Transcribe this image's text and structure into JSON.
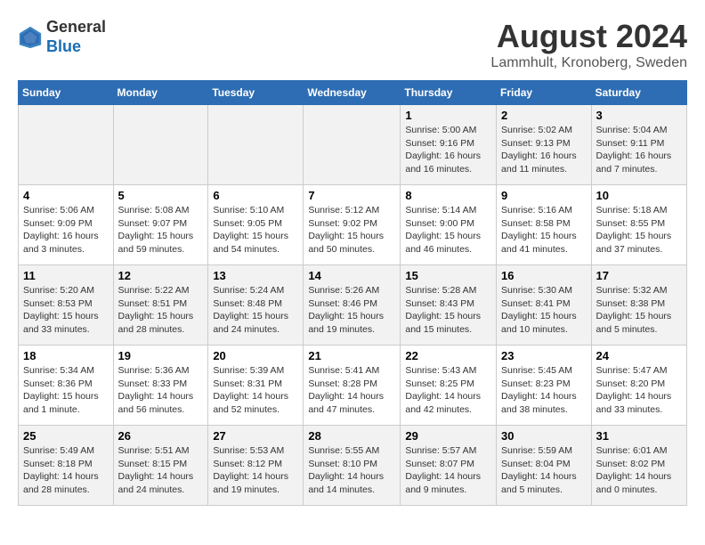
{
  "logo": {
    "general": "General",
    "blue": "Blue"
  },
  "title": "August 2024",
  "subtitle": "Lammhult, Kronoberg, Sweden",
  "weekdays": [
    "Sunday",
    "Monday",
    "Tuesday",
    "Wednesday",
    "Thursday",
    "Friday",
    "Saturday"
  ],
  "weeks": [
    [
      {
        "day": "",
        "info": ""
      },
      {
        "day": "",
        "info": ""
      },
      {
        "day": "",
        "info": ""
      },
      {
        "day": "",
        "info": ""
      },
      {
        "day": "1",
        "info": "Sunrise: 5:00 AM\nSunset: 9:16 PM\nDaylight: 16 hours\nand 16 minutes."
      },
      {
        "day": "2",
        "info": "Sunrise: 5:02 AM\nSunset: 9:13 PM\nDaylight: 16 hours\nand 11 minutes."
      },
      {
        "day": "3",
        "info": "Sunrise: 5:04 AM\nSunset: 9:11 PM\nDaylight: 16 hours\nand 7 minutes."
      }
    ],
    [
      {
        "day": "4",
        "info": "Sunrise: 5:06 AM\nSunset: 9:09 PM\nDaylight: 16 hours\nand 3 minutes."
      },
      {
        "day": "5",
        "info": "Sunrise: 5:08 AM\nSunset: 9:07 PM\nDaylight: 15 hours\nand 59 minutes."
      },
      {
        "day": "6",
        "info": "Sunrise: 5:10 AM\nSunset: 9:05 PM\nDaylight: 15 hours\nand 54 minutes."
      },
      {
        "day": "7",
        "info": "Sunrise: 5:12 AM\nSunset: 9:02 PM\nDaylight: 15 hours\nand 50 minutes."
      },
      {
        "day": "8",
        "info": "Sunrise: 5:14 AM\nSunset: 9:00 PM\nDaylight: 15 hours\nand 46 minutes."
      },
      {
        "day": "9",
        "info": "Sunrise: 5:16 AM\nSunset: 8:58 PM\nDaylight: 15 hours\nand 41 minutes."
      },
      {
        "day": "10",
        "info": "Sunrise: 5:18 AM\nSunset: 8:55 PM\nDaylight: 15 hours\nand 37 minutes."
      }
    ],
    [
      {
        "day": "11",
        "info": "Sunrise: 5:20 AM\nSunset: 8:53 PM\nDaylight: 15 hours\nand 33 minutes."
      },
      {
        "day": "12",
        "info": "Sunrise: 5:22 AM\nSunset: 8:51 PM\nDaylight: 15 hours\nand 28 minutes."
      },
      {
        "day": "13",
        "info": "Sunrise: 5:24 AM\nSunset: 8:48 PM\nDaylight: 15 hours\nand 24 minutes."
      },
      {
        "day": "14",
        "info": "Sunrise: 5:26 AM\nSunset: 8:46 PM\nDaylight: 15 hours\nand 19 minutes."
      },
      {
        "day": "15",
        "info": "Sunrise: 5:28 AM\nSunset: 8:43 PM\nDaylight: 15 hours\nand 15 minutes."
      },
      {
        "day": "16",
        "info": "Sunrise: 5:30 AM\nSunset: 8:41 PM\nDaylight: 15 hours\nand 10 minutes."
      },
      {
        "day": "17",
        "info": "Sunrise: 5:32 AM\nSunset: 8:38 PM\nDaylight: 15 hours\nand 5 minutes."
      }
    ],
    [
      {
        "day": "18",
        "info": "Sunrise: 5:34 AM\nSunset: 8:36 PM\nDaylight: 15 hours\nand 1 minute."
      },
      {
        "day": "19",
        "info": "Sunrise: 5:36 AM\nSunset: 8:33 PM\nDaylight: 14 hours\nand 56 minutes."
      },
      {
        "day": "20",
        "info": "Sunrise: 5:39 AM\nSunset: 8:31 PM\nDaylight: 14 hours\nand 52 minutes."
      },
      {
        "day": "21",
        "info": "Sunrise: 5:41 AM\nSunset: 8:28 PM\nDaylight: 14 hours\nand 47 minutes."
      },
      {
        "day": "22",
        "info": "Sunrise: 5:43 AM\nSunset: 8:25 PM\nDaylight: 14 hours\nand 42 minutes."
      },
      {
        "day": "23",
        "info": "Sunrise: 5:45 AM\nSunset: 8:23 PM\nDaylight: 14 hours\nand 38 minutes."
      },
      {
        "day": "24",
        "info": "Sunrise: 5:47 AM\nSunset: 8:20 PM\nDaylight: 14 hours\nand 33 minutes."
      }
    ],
    [
      {
        "day": "25",
        "info": "Sunrise: 5:49 AM\nSunset: 8:18 PM\nDaylight: 14 hours\nand 28 minutes."
      },
      {
        "day": "26",
        "info": "Sunrise: 5:51 AM\nSunset: 8:15 PM\nDaylight: 14 hours\nand 24 minutes."
      },
      {
        "day": "27",
        "info": "Sunrise: 5:53 AM\nSunset: 8:12 PM\nDaylight: 14 hours\nand 19 minutes."
      },
      {
        "day": "28",
        "info": "Sunrise: 5:55 AM\nSunset: 8:10 PM\nDaylight: 14 hours\nand 14 minutes."
      },
      {
        "day": "29",
        "info": "Sunrise: 5:57 AM\nSunset: 8:07 PM\nDaylight: 14 hours\nand 9 minutes."
      },
      {
        "day": "30",
        "info": "Sunrise: 5:59 AM\nSunset: 8:04 PM\nDaylight: 14 hours\nand 5 minutes."
      },
      {
        "day": "31",
        "info": "Sunrise: 6:01 AM\nSunset: 8:02 PM\nDaylight: 14 hours\nand 0 minutes."
      }
    ]
  ]
}
